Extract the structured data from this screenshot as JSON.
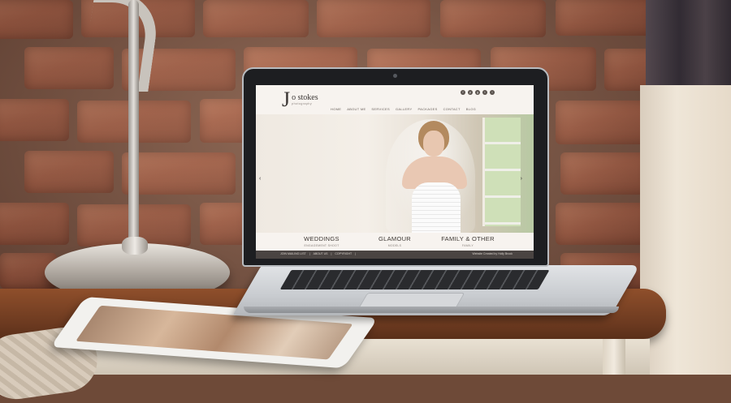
{
  "site": {
    "logo_letter": "J",
    "logo_name": "o stokes",
    "logo_sub": "photography",
    "nav": [
      "HOME",
      "ABOUT ME",
      "SERVICES",
      "GALLERY",
      "PACKAGES",
      "CONTACT",
      "BLOG"
    ],
    "social_icons": [
      "facebook-icon",
      "pinterest-icon",
      "google-plus-icon",
      "twitter-icon",
      "instagram-icon"
    ],
    "slider": {
      "prev": "‹",
      "next": "›"
    },
    "categories": [
      {
        "title": "WEDDINGS",
        "subtitle": "ENGAGEMENT SHOOT"
      },
      {
        "title": "GLAMOUR",
        "subtitle": "MODELS"
      },
      {
        "title": "FAMILY & OTHER",
        "subtitle": "FAMILY"
      }
    ],
    "footer_links": [
      "JOIN MAILING LIST",
      "|",
      "ABOUT US",
      "|",
      "COPYRIGHT",
      "|"
    ],
    "footer_credit": "Website Created by Holly Brook"
  },
  "colors": {
    "brick": "#a85e45",
    "footer_bar": "#4a4442",
    "cabinet_top": "#7a4225"
  }
}
